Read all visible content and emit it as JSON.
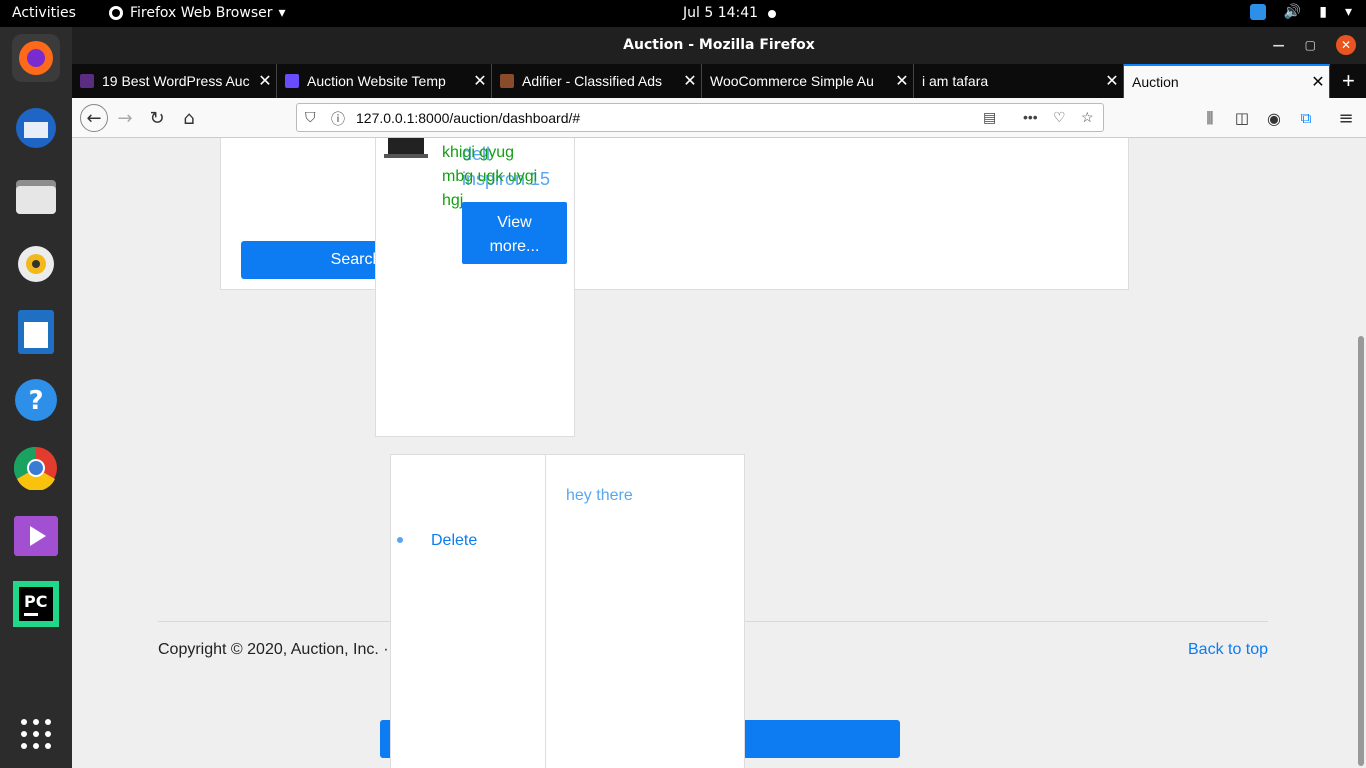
{
  "topbar": {
    "activities": "Activities",
    "app_name": "Firefox Web Browser",
    "clock": "Jul 5  14:41"
  },
  "window": {
    "title": "Auction - Mozilla Firefox"
  },
  "tabs": [
    {
      "label": "19 Best WordPress Auc",
      "favicon_color": "#5a2d82"
    },
    {
      "label": "Auction Website Temp",
      "favicon_color": "#6a4cff"
    },
    {
      "label": "Adifier - Classified Ads",
      "favicon_color": "#8a4b2a"
    },
    {
      "label": "WooCommerce Simple Au",
      "favicon_color": ""
    },
    {
      "label": "i am tafara",
      "favicon_color": ""
    },
    {
      "label": "Auction",
      "favicon_color": ""
    }
  ],
  "address_bar": {
    "url": "127.0.0.1:8000/auction/dashboard/#"
  },
  "page": {
    "search_button": "Search",
    "product": {
      "desc_line1": "khigi gyug",
      "desc_line2": "mbg ugk uygi",
      "desc_line3": "hgj",
      "title_line1": "dell",
      "title_line2": "inspiron 15",
      "view_more_line1": "View",
      "view_more_line2": "more..."
    },
    "delete_link": "Delete",
    "message": "hey there",
    "copyright": "Copyright © 2020, Auction, Inc. ·",
    "back_to_top": "Back to top"
  },
  "colors": {
    "primary_button": "#0d7cf2",
    "green_text": "#12a012",
    "accent_orange": "#e95420"
  }
}
